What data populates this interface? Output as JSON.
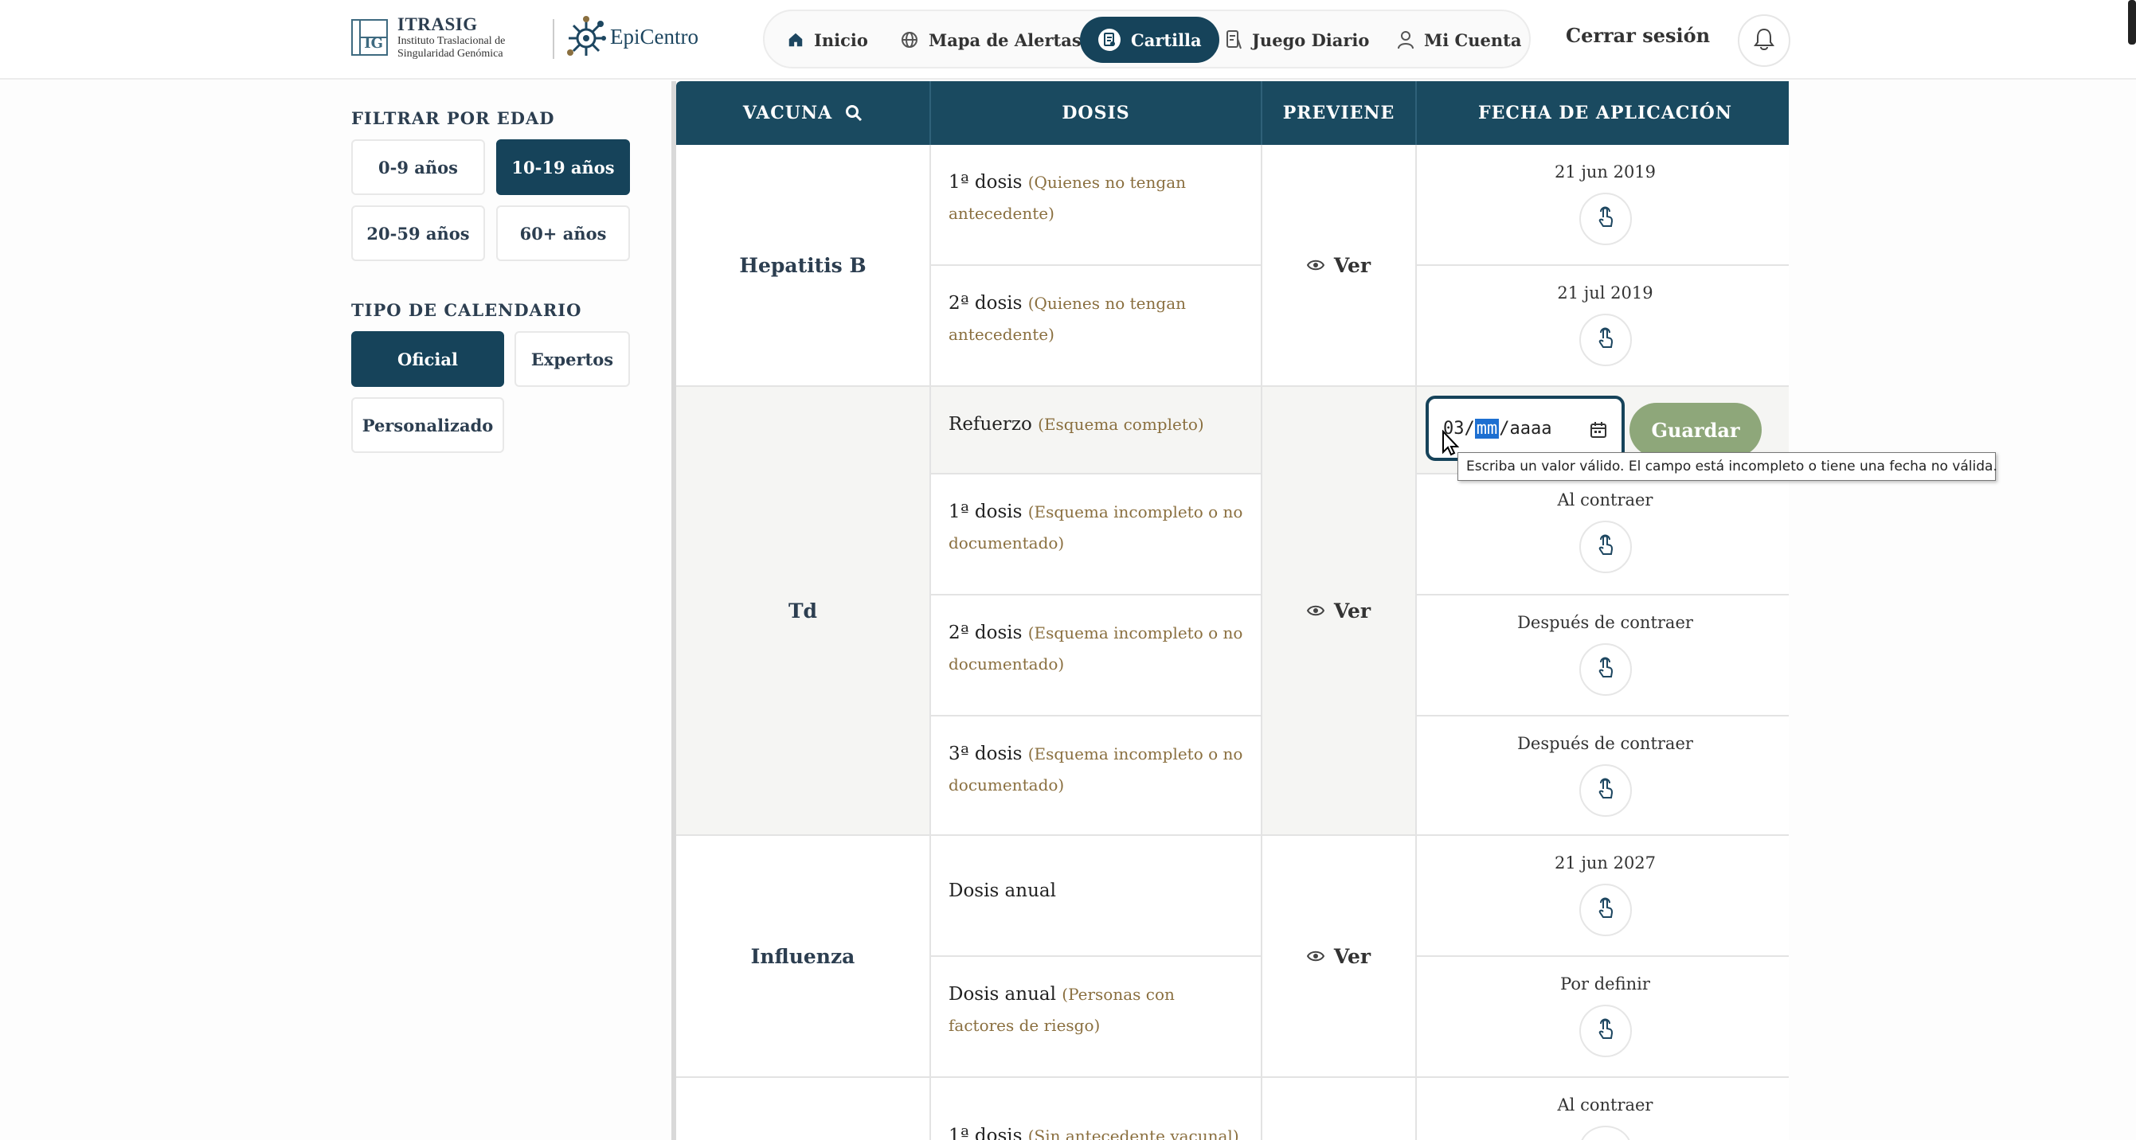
{
  "header": {
    "logo_title": "ITRASIG",
    "logo_subtitle_1": "Instituto Traslacional de",
    "logo_subtitle_2": "Singularidad Genómica",
    "logo_mark": "IG",
    "epi_name": "EpiCentro",
    "nav": [
      {
        "label": "Inicio",
        "icon": "home-icon"
      },
      {
        "label": "Mapa de Alertas",
        "icon": "globe-icon"
      },
      {
        "label": "Cartilla",
        "icon": "document-icon",
        "active": true
      },
      {
        "label": "Juego Diario",
        "icon": "game-icon"
      },
      {
        "label": "Mi Cuenta",
        "icon": "user-icon"
      }
    ],
    "logout": "Cerrar sesión"
  },
  "sidebar": {
    "age_title": "FILTRAR POR EDAD",
    "ages": [
      "0-9 años",
      "10-19 años",
      "20-59 años",
      "60+ años"
    ],
    "active_age": "10-19 años",
    "calendar_title": "TIPO DE CALENDARIO",
    "calendars": [
      "Oficial",
      "Expertos",
      "Personalizado"
    ],
    "active_calendar": "Oficial"
  },
  "table": {
    "headers": [
      "VACUNA",
      "DOSIS",
      "PREVIENE",
      "FECHA DE APLICACIÓN"
    ],
    "see_label": "Ver",
    "vaccines": [
      {
        "name": "Hepatitis B",
        "doses": [
          {
            "dose": "1ª dosis",
            "note": "(Quienes no tengan antecedente)",
            "date": "21 jun 2019"
          },
          {
            "dose": "2ª dosis",
            "note": "(Quienes no tengan antecedente)",
            "date": "21 jul 2019"
          }
        ]
      },
      {
        "name": "Td",
        "doses": [
          {
            "dose": "Refuerzo",
            "note": "(Esquema completo)",
            "date": ""
          },
          {
            "dose": "1ª dosis",
            "note": "(Esquema incompleto o no documentado)",
            "date": "Al contraer"
          },
          {
            "dose": "2ª dosis",
            "note": "(Esquema incompleto o no documentado)",
            "date": "Después de contraer"
          },
          {
            "dose": "3ª dosis",
            "note": "(Esquema incompleto o no documentado)",
            "date": "Después de contraer"
          }
        ]
      },
      {
        "name": "Influenza",
        "doses": [
          {
            "dose": "Dosis anual",
            "note": "",
            "date": "21 jun 2027"
          },
          {
            "dose": "Dosis anual",
            "note": "(Personas con factores de riesgo)",
            "date": "Por definir"
          }
        ]
      },
      {
        "name": "",
        "doses": [
          {
            "dose": "1ª dosis",
            "note": "(Sin antecedente vacunal)",
            "date": "Al contraer"
          }
        ]
      }
    ]
  },
  "date_input": {
    "day": "03",
    "month": "mm",
    "year": "aaaa",
    "save_label": "Guardar",
    "tooltip": "Escriba un valor válido. El campo está incompleto o tiene una fecha no válida."
  }
}
